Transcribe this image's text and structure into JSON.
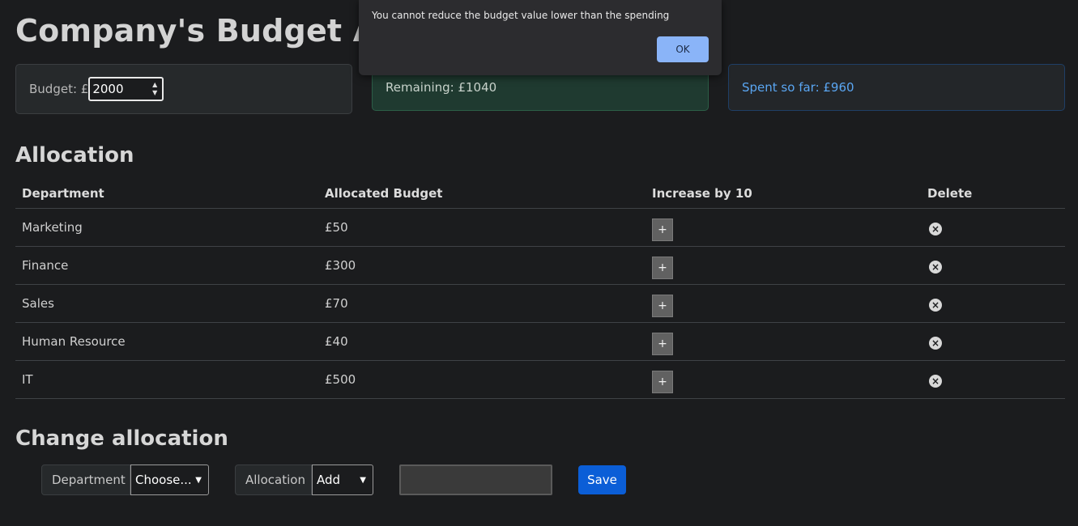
{
  "page": {
    "title": "Company's Budget Allo"
  },
  "cards": {
    "budget_label": "Budget: £",
    "budget_value": "2000",
    "remaining": "Remaining: £1040",
    "spent": "Spent so far: £960"
  },
  "allocation": {
    "heading": "Allocation",
    "columns": [
      "Department",
      "Allocated Budget",
      "Increase by 10",
      "Delete"
    ],
    "rows": [
      {
        "department": "Marketing",
        "budget": "£50",
        "increase_label": "+"
      },
      {
        "department": "Finance",
        "budget": "£300",
        "increase_label": "+"
      },
      {
        "department": "Sales",
        "budget": "£70",
        "increase_label": "+"
      },
      {
        "department": "Human Resource",
        "budget": "£40",
        "increase_label": "+"
      },
      {
        "department": "IT",
        "budget": "£500",
        "increase_label": "+"
      }
    ]
  },
  "change": {
    "heading": "Change allocation",
    "department_label": "Department",
    "department_selected": "Choose...",
    "allocation_label": "Allocation",
    "allocation_selected": "Add",
    "amount_value": "",
    "save_label": "Save"
  },
  "dialog": {
    "message": "You cannot reduce the budget value lower than the spending",
    "ok_label": "OK"
  },
  "icons": {
    "delete": "close-circle-icon",
    "spin": "spinner-arrows-icon",
    "select": "chevron-down-icon"
  },
  "colors": {
    "save_button": "#0b5ed7",
    "dialog_ok": "#8ab4f8",
    "spent_text": "#5aa6f2",
    "remaining_bg": "#1f3a30"
  }
}
